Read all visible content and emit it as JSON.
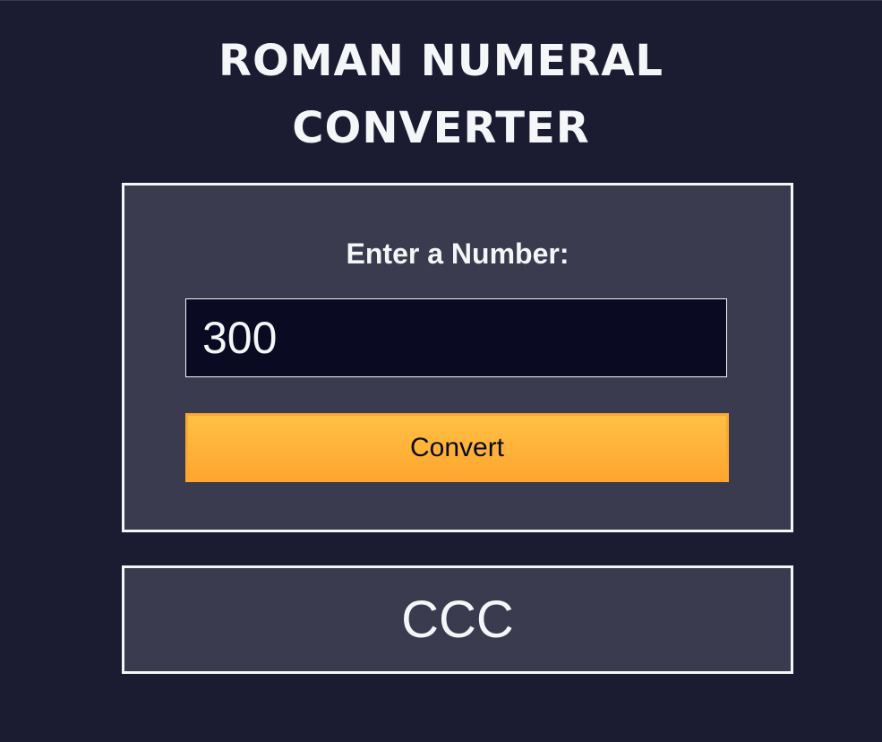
{
  "title_line1": "ROMAN NUMERAL",
  "title_line2": "CONVERTER",
  "form": {
    "label": "Enter a Number:",
    "input_value": "300",
    "convert_label": "Convert"
  },
  "output": "CCC"
}
